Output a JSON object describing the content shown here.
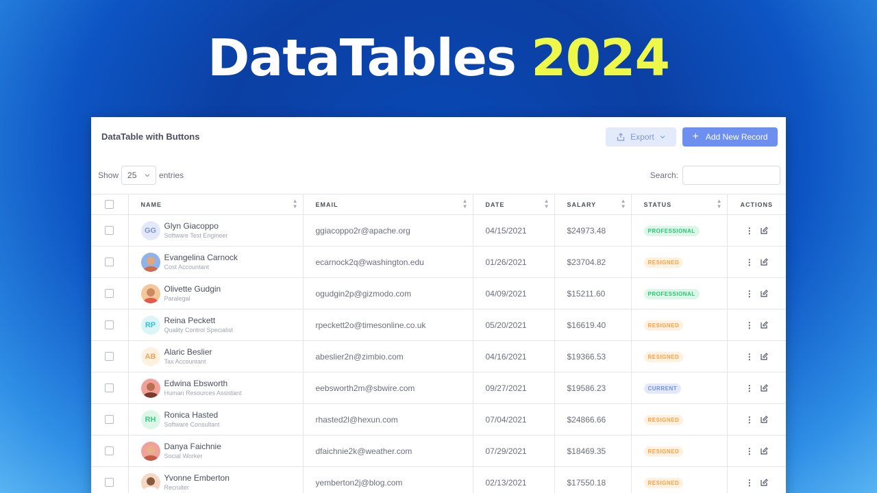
{
  "hero": {
    "title_white": "DataTables",
    "title_yellow": "2024",
    "colors": {
      "white": "#ffffff",
      "yellow": "#eef84a"
    }
  },
  "card": {
    "title": "DataTable with Buttons",
    "export_label": "Export",
    "add_label": "Add New Record",
    "show_label": "Show",
    "entries_value": "25",
    "entries_label": "entries",
    "search_label": "Search:",
    "search_value": ""
  },
  "table": {
    "columns": [
      "NAME",
      "EMAIL",
      "DATE",
      "SALARY",
      "STATUS",
      "ACTIONS"
    ],
    "rows": [
      {
        "avatar": {
          "type": "initials",
          "text": "GG",
          "bg": "#e4e9f9",
          "fg": "#7b95d8"
        },
        "name": "Glyn Giacoppo",
        "role": "Software Test Engineer",
        "email": "ggiacoppo2r@apache.org",
        "date": "04/15/2021",
        "salary": "$24973.48",
        "status": "PROFESSIONAL",
        "status_bg": "#dcf6e8",
        "status_fg": "#28c76f"
      },
      {
        "avatar": {
          "type": "photo",
          "bg": "#8fb3e8",
          "head": "#e0a77c",
          "body": "#d26a4c"
        },
        "name": "Evangelina Carnock",
        "role": "Cost Accountant",
        "email": "ecarnock2q@washington.edu",
        "date": "01/26/2021",
        "salary": "$23704.82",
        "status": "RESIGNED",
        "status_bg": "#fff1e0",
        "status_fg": "#ff9f43"
      },
      {
        "avatar": {
          "type": "photo",
          "bg": "#f4c79a",
          "head": "#c98a62",
          "body": "#e35a4a"
        },
        "name": "Olivette Gudgin",
        "role": "Paralegal",
        "email": "ogudgin2p@gizmodo.com",
        "date": "04/09/2021",
        "salary": "$15211.60",
        "status": "PROFESSIONAL",
        "status_bg": "#dcf6e8",
        "status_fg": "#28c76f"
      },
      {
        "avatar": {
          "type": "initials",
          "text": "RP",
          "bg": "#dcf6f8",
          "fg": "#2cc3d6"
        },
        "name": "Reina Peckett",
        "role": "Quality Control Specialist",
        "email": "rpeckett2o@timesonline.co.uk",
        "date": "05/20/2021",
        "salary": "$16619.40",
        "status": "RESIGNED",
        "status_bg": "#fff1e0",
        "status_fg": "#ff9f43"
      },
      {
        "avatar": {
          "type": "initials",
          "text": "AB",
          "bg": "#fff1e0",
          "fg": "#f0a35a"
        },
        "name": "Alaric Beslier",
        "role": "Tax Accountant",
        "email": "abeslier2n@zimbio.com",
        "date": "04/16/2021",
        "salary": "$19366.53",
        "status": "RESIGNED",
        "status_bg": "#fff1e0",
        "status_fg": "#ff9f43"
      },
      {
        "avatar": {
          "type": "photo",
          "bg": "#f0a29a",
          "head": "#b86e50",
          "body": "#7a3b2e"
        },
        "name": "Edwina Ebsworth",
        "role": "Human Resources Assistant",
        "email": "eebsworth2m@sbwire.com",
        "date": "09/27/2021",
        "salary": "$19586.23",
        "status": "CURRENT",
        "status_bg": "#e4e9f9",
        "status_fg": "#6d8ff0"
      },
      {
        "avatar": {
          "type": "initials",
          "text": "RH",
          "bg": "#dcf6e8",
          "fg": "#3ecb83"
        },
        "name": "Ronica Hasted",
        "role": "Software Consultant",
        "email": "rhasted2l@hexun.com",
        "date": "07/04/2021",
        "salary": "$24866.66",
        "status": "RESIGNED",
        "status_bg": "#fff1e0",
        "status_fg": "#ff9f43"
      },
      {
        "avatar": {
          "type": "photo",
          "bg": "#f0a29a",
          "head": "#e6b28a",
          "body": "#c35a44"
        },
        "name": "Danya Faichnie",
        "role": "Social Worker",
        "email": "dfaichnie2k@weather.com",
        "date": "07/29/2021",
        "salary": "$18469.35",
        "status": "RESIGNED",
        "status_bg": "#fff1e0",
        "status_fg": "#ff9f43"
      },
      {
        "avatar": {
          "type": "photo",
          "bg": "#f4d8c4",
          "head": "#8a5a3c",
          "body": "#ffffff"
        },
        "name": "Yvonne Emberton",
        "role": "Recruiter",
        "email": "yemberton2j@blog.com",
        "date": "02/13/2021",
        "salary": "$17550.18",
        "status": "RESIGNED",
        "status_bg": "#fff1e0",
        "status_fg": "#ff9f43"
      }
    ]
  }
}
